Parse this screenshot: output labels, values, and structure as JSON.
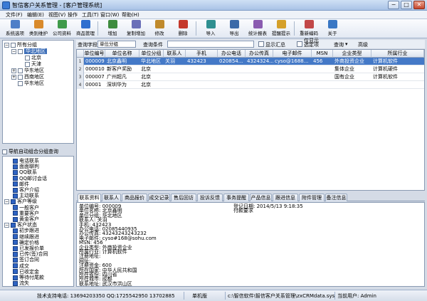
{
  "window": {
    "title": "智信客户关系管理 - [客户管理系统]",
    "minimize": "−",
    "maximize": "□",
    "close": "✕"
  },
  "menu": [
    "文件(F)",
    "编辑(E)",
    "视图(V)",
    "操作",
    "工具(T)",
    "窗口(W)",
    "帮助(H)"
  ],
  "toolbar": [
    {
      "label": "系统选项",
      "icon": "settings-icon",
      "color": "#4f7fc8"
    },
    {
      "label": "类别维护",
      "icon": "category-icon",
      "color": "#d98a2b"
    },
    {
      "label": "公司资料",
      "icon": "company-icon",
      "color": "#3f9a4a"
    },
    {
      "label": "商品管理",
      "icon": "goods-icon",
      "color": "#2f6fcf"
    },
    {
      "label": "增加",
      "icon": "add-icon",
      "color": "#3e8b3e"
    },
    {
      "label": "复制增加",
      "icon": "copy-add-icon",
      "color": "#6a6fb8"
    },
    {
      "label": "修改",
      "icon": "edit-icon",
      "color": "#c08a2c"
    },
    {
      "label": "删除",
      "icon": "delete-icon",
      "color": "#c4382b"
    },
    {
      "label": "导入",
      "icon": "import-icon",
      "color": "#2f8f90"
    },
    {
      "label": "导出",
      "icon": "export-icon",
      "color": "#3b6aa8"
    },
    {
      "label": "统计报表",
      "icon": "report-icon",
      "color": "#8a5bb0"
    },
    {
      "label": "提醒提示",
      "icon": "reminder-icon",
      "color": "#d5a02a"
    },
    {
      "label": "重新编码",
      "icon": "recode-icon",
      "color": "#c24848"
    },
    {
      "label": "关于",
      "icon": "about-icon",
      "color": "#3a77c4"
    }
  ],
  "tree": {
    "root": "所有分组",
    "nodes": [
      {
        "label": "华北地区",
        "level": 1,
        "expander": "−",
        "selected": true
      },
      {
        "label": "北京",
        "level": 2
      },
      {
        "label": "天津",
        "level": 2
      },
      {
        "label": "华东地区",
        "level": 1,
        "expander": "+"
      },
      {
        "label": "西南地区",
        "level": 1,
        "expander": "+"
      },
      {
        "label": "华东地区",
        "level": 1
      }
    ]
  },
  "auto_group_label": "导航自动组合分组查询",
  "nav_list": [
    {
      "label": "电话联系",
      "level": 2
    },
    {
      "label": "面面聊判",
      "level": 2
    },
    {
      "label": "QQ联系",
      "level": 2
    },
    {
      "label": "QQ邮讨会话",
      "level": 2
    },
    {
      "label": "邮件",
      "level": 2
    },
    {
      "label": "客户介绍",
      "level": 2
    },
    {
      "label": "主动联系",
      "level": 2
    },
    {
      "label": "客户等级",
      "level": 1,
      "expander": "−"
    },
    {
      "label": "一般客户",
      "level": 2
    },
    {
      "label": "重要客户",
      "level": 2
    },
    {
      "label": "黄金客户",
      "level": 2
    },
    {
      "label": "客户状态",
      "level": 1,
      "expander": "−"
    },
    {
      "label": "初步跟进",
      "level": 2
    },
    {
      "label": "继续跟进",
      "level": 2
    },
    {
      "label": "确定价格",
      "level": 2
    },
    {
      "label": "已发报价单",
      "level": 2
    },
    {
      "label": "已传(签)合同",
      "level": 2
    },
    {
      "label": "签订合同",
      "level": 2
    },
    {
      "label": "成交",
      "level": 2
    },
    {
      "label": "已收定金",
      "level": 2
    },
    {
      "label": "等待付尾款",
      "level": 2
    },
    {
      "label": "流失",
      "level": 2
    }
  ],
  "filter": {
    "field_label": "查询字段",
    "field_value": "单位分组",
    "cond_label": "查询条件",
    "cond_value": "",
    "summary_label": "显示汇总",
    "extra_label": "仅显示\n选定项",
    "query_label": "查询",
    "advanced_label": "高级"
  },
  "grid": {
    "columns": [
      "单位编号",
      "单位名称",
      "单位分组",
      "联系人",
      "手机",
      "办公电话",
      "办公传真",
      "电子邮件",
      "MSN",
      "企业类型",
      "所属行业"
    ],
    "rows": [
      {
        "num": "1",
        "cells": [
          "000009",
          "北京鑫明",
          "华北地区",
          "关羽",
          "432423",
          "020854...",
          "4324324...",
          "cyso@1688...",
          "456",
          "外商投资企业",
          "计算机软件"
        ],
        "selected": true
      },
      {
        "num": "2",
        "cells": [
          "000010",
          "新客户奖励",
          "北京",
          "",
          "",
          "",
          "",
          "",
          "",
          "集体企业",
          "计算机硬件"
        ]
      },
      {
        "num": "3",
        "cells": [
          "000007",
          "广州超凡",
          "北京",
          "",
          "",
          "",
          "",
          "",
          "",
          "国有企业",
          "计算机软件"
        ]
      },
      {
        "num": "4",
        "cells": [
          "00001",
          "深圳华为",
          "北京",
          "",
          "",
          "",
          "",
          "",
          "",
          "",
          ""
        ]
      }
    ]
  },
  "tabs": [
    "联系资料",
    "联系人",
    "商品报价",
    "成交记录",
    "售后回访",
    "投诉反馈",
    "事务提醒",
    "产品信息",
    "跟进信息",
    "附件管理",
    "备注信息"
  ],
  "detail": {
    "left_lines": [
      "单位编号: 000009",
      "单位名称: 北京鑫明",
      "单位分组: 华北地区",
      "联系人: 关羽",
      "手机: 432423",
      "办公电话: 02085440935",
      "办公传真: 43243243243232",
      "电子邮件: cyso#168@sohu.com",
      "MSN: 456",
      "企业类型: 外商投资企业",
      "所属行业: 计算机软件",
      "注册地址:",
      "网址:",
      "注册资金: 600",
      "所在国家: 中华人民共和国",
      "所在省份: 四川省",
      "所在城市: 成都",
      "联系地址: 武汉市洪山区"
    ],
    "right_lines": [
      "登记日期: 2014/5/13 9:18:35",
      "付款要求"
    ]
  },
  "status": {
    "support": "技术支持电话: 13694203350 QQ:1725542950 13702885",
    "edition": "单机版",
    "db_path": "c:\\智信软件\\智信客户关系管理\\zxCRMdata.sys",
    "user": "当前用户: Admin"
  }
}
